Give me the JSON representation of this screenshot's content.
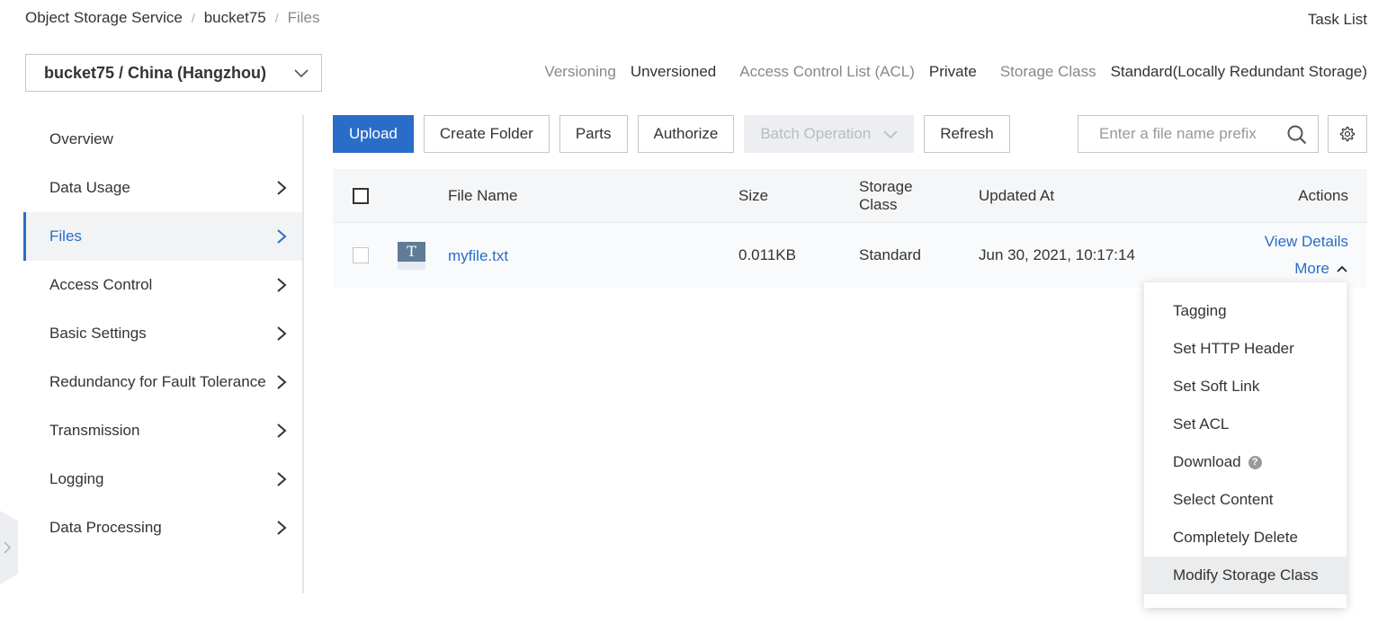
{
  "breadcrumb": [
    "Object Storage Service",
    "bucket75",
    "Files"
  ],
  "header": {
    "task_list": "Task List"
  },
  "bucket_selector": {
    "value": "bucket75 / China (Hangzhou)"
  },
  "bucket_meta": {
    "versioning_label": "Versioning",
    "versioning_value": "Unversioned",
    "acl_label": "Access Control List (ACL)",
    "acl_value": "Private",
    "storage_class_label": "Storage Class",
    "storage_class_value": "Standard(Locally Redundant Storage)"
  },
  "sidebar": {
    "items": [
      {
        "label": "Overview",
        "has_arrow": false,
        "active": false
      },
      {
        "label": "Data Usage",
        "has_arrow": true,
        "active": false
      },
      {
        "label": "Files",
        "has_arrow": true,
        "active": true
      },
      {
        "label": "Access Control",
        "has_arrow": true,
        "active": false
      },
      {
        "label": "Basic Settings",
        "has_arrow": true,
        "active": false
      },
      {
        "label": "Redundancy for Fault Tolerance",
        "has_arrow": true,
        "active": false
      },
      {
        "label": "Transmission",
        "has_arrow": true,
        "active": false
      },
      {
        "label": "Logging",
        "has_arrow": true,
        "active": false
      },
      {
        "label": "Data Processing",
        "has_arrow": true,
        "active": false
      }
    ]
  },
  "toolbar": {
    "upload": "Upload",
    "create_folder": "Create Folder",
    "parts": "Parts",
    "authorize": "Authorize",
    "batch_operation": "Batch Operation",
    "refresh": "Refresh"
  },
  "search": {
    "placeholder": "Enter a file name prefix"
  },
  "table": {
    "headers": {
      "file_name": "File Name",
      "size": "Size",
      "storage_class": "Storage\nClass",
      "updated_at": "Updated At",
      "actions": "Actions"
    },
    "rows": [
      {
        "icon_letter": "T",
        "file_name": "myfile.txt",
        "size": "0.011KB",
        "storage_class": "Standard",
        "updated_at": "Jun 30, 2021, 10:17:14",
        "view_details": "View Details",
        "more": "More"
      }
    ]
  },
  "more_menu": {
    "items": [
      "Tagging",
      "Set HTTP Header",
      "Set Soft Link",
      "Set ACL",
      "Download",
      "Select Content",
      "Completely Delete",
      "Modify Storage Class"
    ],
    "help_icon_text": "?"
  },
  "colors": {
    "accent": "#2a6dc9",
    "disabled_bg": "#eceef1",
    "border": "#c4c6cf"
  }
}
